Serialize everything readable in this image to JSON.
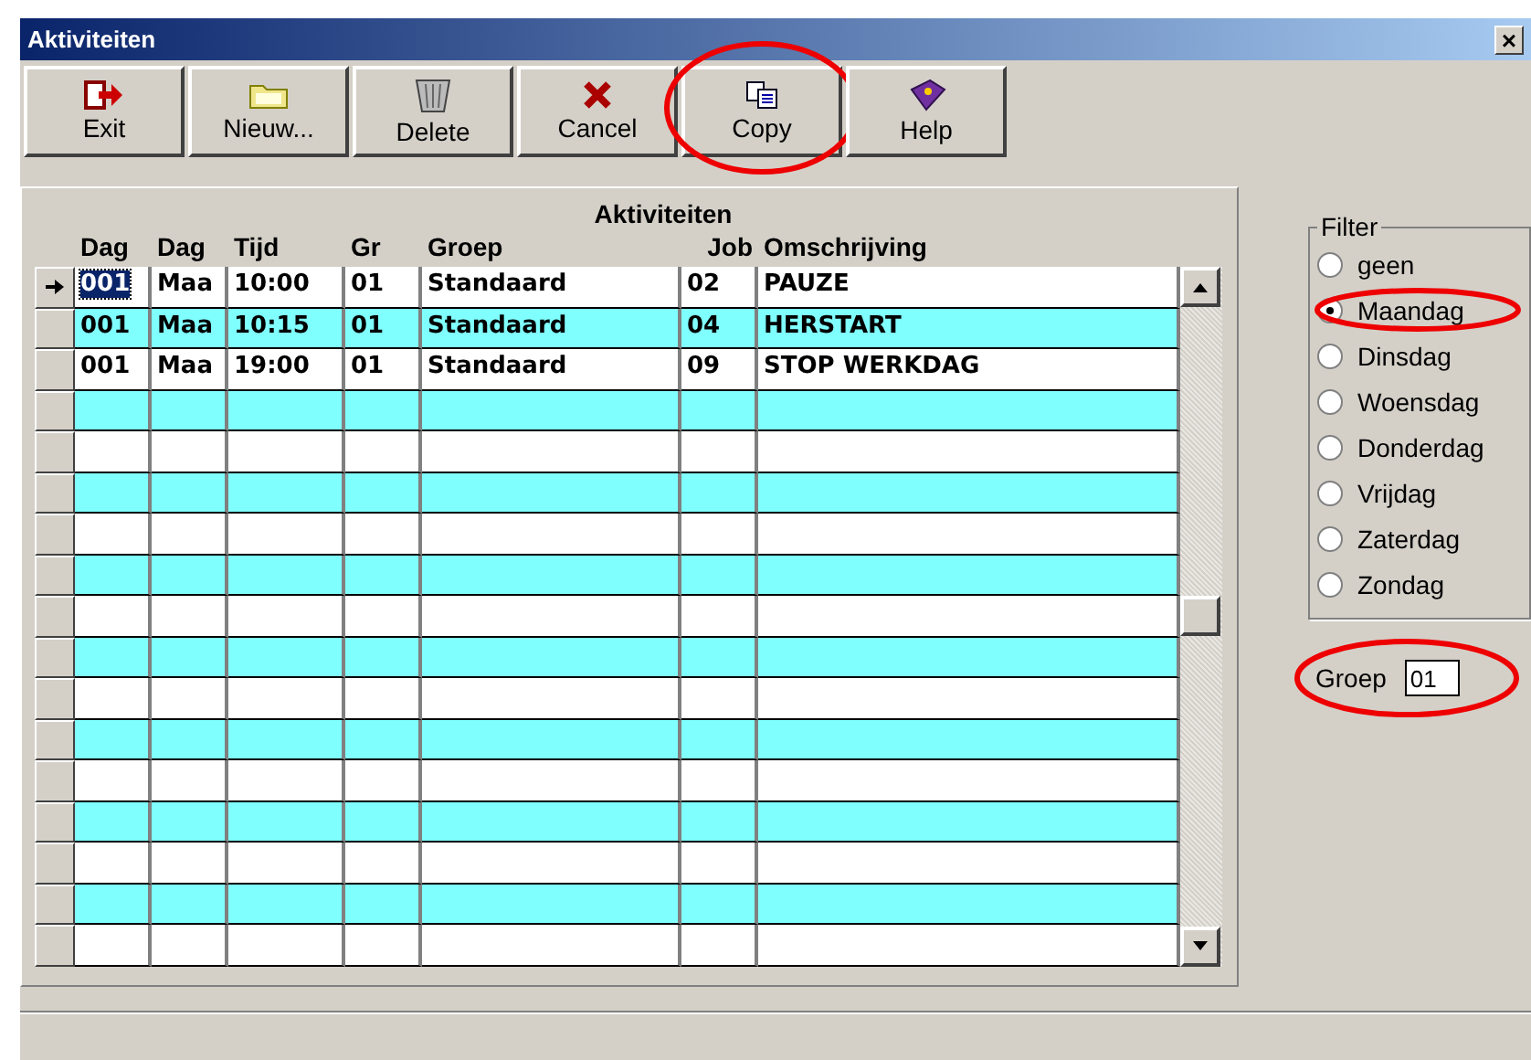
{
  "window": {
    "title": "Aktiviteiten",
    "close": "×"
  },
  "toolbar": [
    {
      "label": "Exit",
      "kind": "exit",
      "highlighted": false
    },
    {
      "label": "Nieuw...",
      "kind": "new",
      "highlighted": false
    },
    {
      "label": "Delete",
      "kind": "delete",
      "highlighted": false
    },
    {
      "label": "Cancel",
      "kind": "cancel",
      "highlighted": false
    },
    {
      "label": "Copy",
      "kind": "copy",
      "highlighted": true
    },
    {
      "label": "Help",
      "kind": "help",
      "highlighted": false
    }
  ],
  "grid": {
    "title": "Aktiviteiten",
    "columns": [
      "Dag",
      "Dag",
      "Tijd",
      "Gr",
      "Groep",
      "Job",
      "Omschrijving"
    ],
    "rows": [
      {
        "current": true,
        "cells": [
          "001",
          "Maa",
          "10:00",
          "01",
          "Standaard",
          "02",
          "PAUZE"
        ]
      },
      {
        "current": false,
        "cells": [
          "001",
          "Maa",
          "10:15",
          "01",
          "Standaard",
          "04",
          "HERSTART"
        ]
      },
      {
        "current": false,
        "cells": [
          "001",
          "Maa",
          "19:00",
          "01",
          "Standaard",
          "09",
          "STOP WERKDAG"
        ]
      }
    ]
  },
  "filter": {
    "title": "Filter",
    "options": [
      {
        "label": "geen",
        "selected": false,
        "highlighted": false
      },
      {
        "label": "Maandag",
        "selected": true,
        "highlighted": true
      },
      {
        "label": "Dinsdag",
        "selected": false,
        "highlighted": false
      },
      {
        "label": "Woensdag",
        "selected": false,
        "highlighted": false
      },
      {
        "label": "Donderdag",
        "selected": false,
        "highlighted": false
      },
      {
        "label": "Vrijdag",
        "selected": false,
        "highlighted": false
      },
      {
        "label": "Zaterdag",
        "selected": false,
        "highlighted": false
      },
      {
        "label": "Zondag",
        "selected": false,
        "highlighted": false
      }
    ]
  },
  "groep": {
    "label": "Groep",
    "value": "01",
    "highlighted": true
  }
}
